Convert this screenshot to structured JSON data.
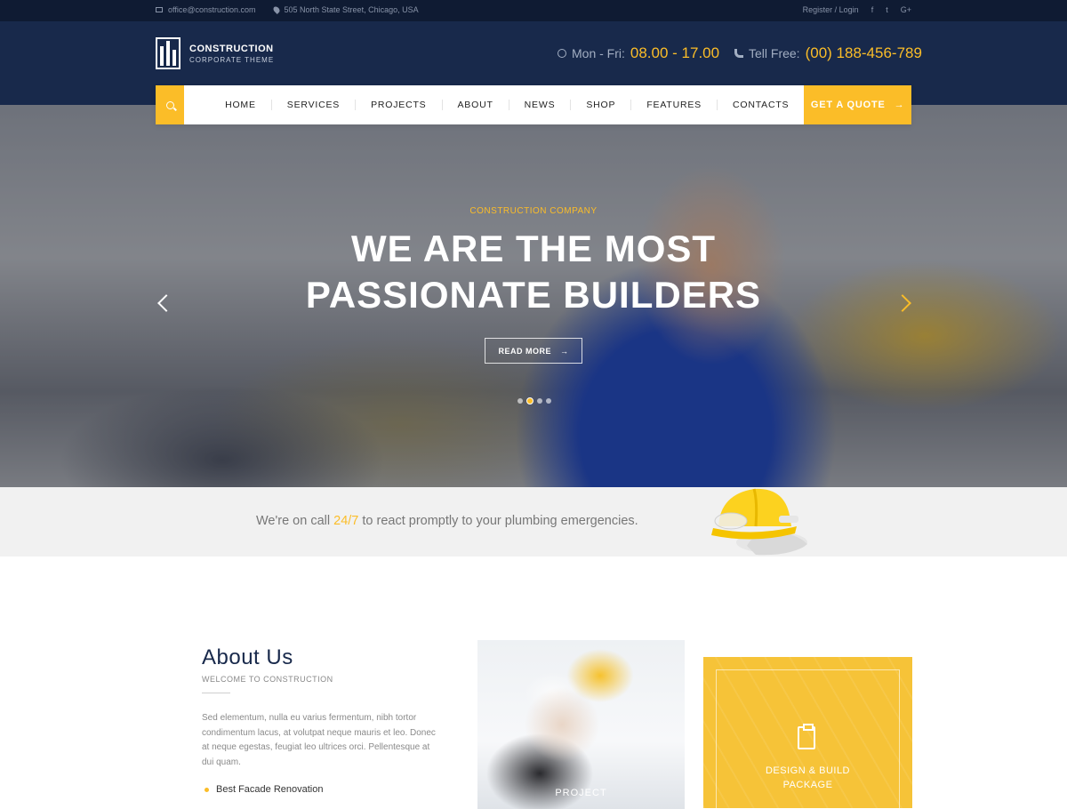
{
  "topbar": {
    "email": "office@construction.com",
    "address": "505 North State Street, Chicago, USA",
    "auth": "Register / Login",
    "social": [
      "f",
      "t",
      "G+"
    ]
  },
  "header": {
    "logo_title": "CONSTRUCTION",
    "logo_subtitle": "CORPORATE THEME",
    "hours_label": "Mon - Fri:",
    "hours_value": "08.00 - 17.00",
    "phone_label": "Tell Free:",
    "phone_value": "(00) 188-456-789"
  },
  "nav": {
    "items": [
      "HOME",
      "SERVICES",
      "PROJECTS",
      "ABOUT",
      "NEWS",
      "SHOP",
      "FEATURES",
      "CONTACTS"
    ],
    "quote": "GET A QUOTE",
    "quote_arrow": "→"
  },
  "hero": {
    "eyebrow": "CONSTRUCTION COMPANY",
    "title_line1": "WE ARE THE MOST",
    "title_line2": "PASSIONATE BUILDERS",
    "cta": "READ MORE",
    "cta_arrow": "→",
    "slide_count": 4,
    "active_slide": 2
  },
  "strip": {
    "pre": "We're on call ",
    "highlight": "24/7",
    "post": " to react promptly to your plumbing emergencies."
  },
  "about": {
    "title": "About Us",
    "subtitle": "WELCOME TO CONSTRUCTION",
    "body": "Sed elementum, nulla eu varius fermentum, nibh tortor condimentum lacus, at volutpat neque mauris et leo. Donec at neque egestas, feugiat leo ultrices orci. Pellentesque at dui quam.",
    "bullet": "Best Facade Renovation",
    "card1_label": "PROJECT",
    "card2_label_line1": "DESIGN & BUILD",
    "card2_label_line2": "PACKAGE"
  },
  "colors": {
    "accent": "#fbbd28",
    "header_bg": "#18294b",
    "topbar_bg": "#0f1b33"
  }
}
